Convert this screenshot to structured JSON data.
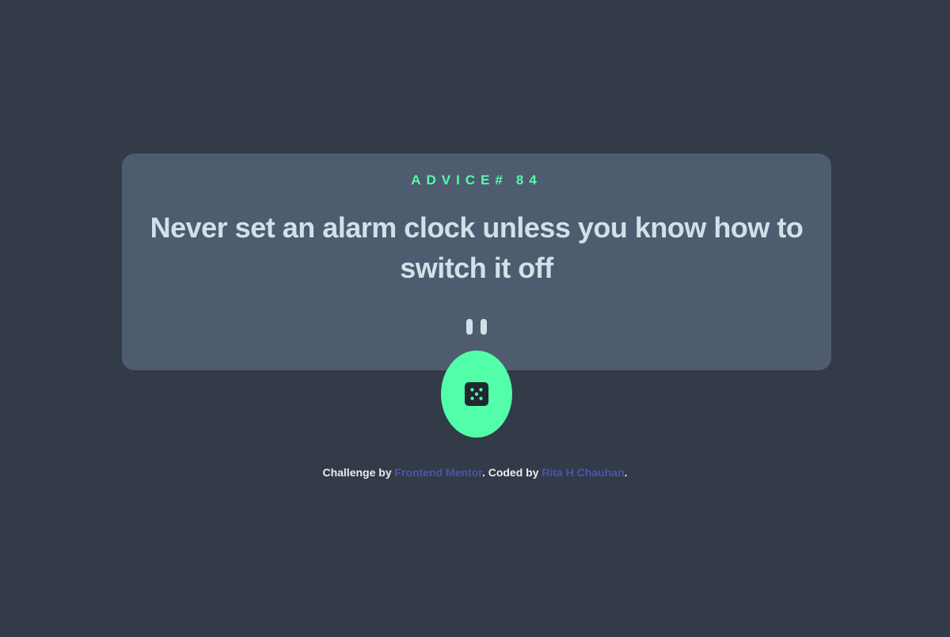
{
  "advice": {
    "label": "ADVICE#",
    "number": "84",
    "text": "Never set an alarm clock unless you know how to switch it off"
  },
  "dice_button": {
    "icon": "dice-icon"
  },
  "divider": {
    "icon": "pause-divider-icon"
  },
  "attribution": {
    "prefix": "Challenge by",
    "challenge_link": "Frontend Mentor",
    "middle": ". Coded by",
    "author_link": "Rita H Chauhan",
    "suffix": "."
  },
  "colors": {
    "background": "#333a48",
    "card": "#4f5b6f",
    "accent": "#52ffa8",
    "text": "#cee3e9",
    "link": "#4b55a8"
  }
}
